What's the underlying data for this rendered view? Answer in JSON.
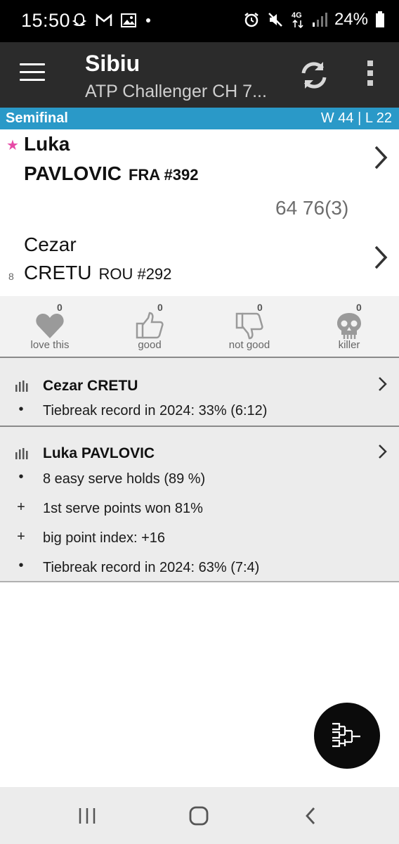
{
  "status_bar": {
    "time": "15:50",
    "battery_percent": "24%",
    "network": "4G",
    "left_icons": [
      "snapchat-icon",
      "gmail-icon",
      "gallery-icon",
      "dot-icon"
    ],
    "right_icons": [
      "alarm-icon",
      "mute-icon",
      "4g-icon",
      "signal-icon",
      "battery-icon"
    ]
  },
  "app_bar": {
    "title": "Sibiu",
    "subtitle": "ATP Challenger CH 7..."
  },
  "round": {
    "label": "Semifinal",
    "record": "W 44 | L 22"
  },
  "match": {
    "player1": {
      "first_name": "Luka",
      "last_name": "PAVLOVIC",
      "country_rank": "FRA #392",
      "favorite": true
    },
    "player2": {
      "first_name": "Cezar",
      "last_name": "CRETU",
      "country_rank": "ROU #292",
      "seed": "8"
    },
    "score": "64 76(3)"
  },
  "reactions": [
    {
      "label": "love this",
      "count": "0",
      "icon": "heart-icon"
    },
    {
      "label": "good",
      "count": "0",
      "icon": "thumbs-up-icon"
    },
    {
      "label": "not good",
      "count": "0",
      "icon": "thumbs-down-icon"
    },
    {
      "label": "killer",
      "count": "0",
      "icon": "skull-icon"
    }
  ],
  "stats": [
    {
      "player": "Cezar CRETU",
      "rows": [
        {
          "bullet": "•",
          "text": "Tiebreak record in 2024: 33% (6:12)"
        }
      ]
    },
    {
      "player": "Luka PAVLOVIC",
      "rows": [
        {
          "bullet": "•",
          "text": "8 easy serve holds (89 %)"
        },
        {
          "bullet": "+",
          "text": "1st serve points won 81%"
        },
        {
          "bullet": "+",
          "text": "big point index: +16"
        },
        {
          "bullet": "•",
          "text": "Tiebreak record in 2024: 63% (7:4)"
        }
      ]
    }
  ],
  "fab": {
    "icon": "bracket-icon"
  },
  "nav_bar": {
    "icons": [
      "recent-apps-icon",
      "home-icon",
      "back-icon"
    ]
  },
  "colors": {
    "round_bar": "#2a99c8",
    "app_bar": "#2b2b2b",
    "favorite_star": "#e64aa6",
    "panel_bg": "#ececec"
  }
}
